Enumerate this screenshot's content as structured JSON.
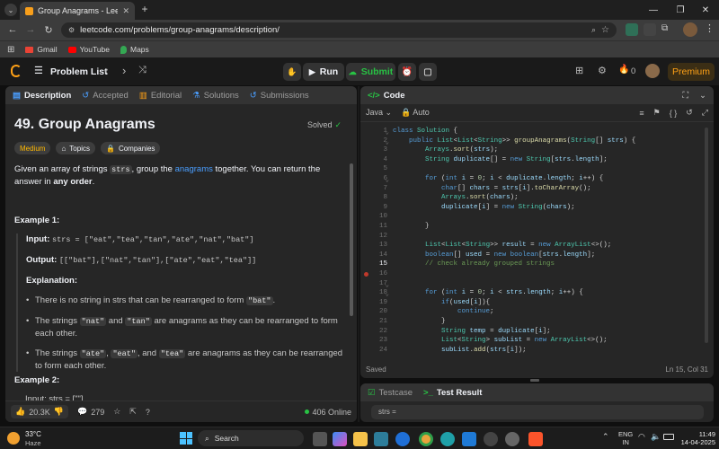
{
  "browser": {
    "tab_title": "Group Anagrams - LeetCode",
    "url": "leetcode.com/problems/group-anagrams/description/",
    "bookmarks": [
      {
        "label": "Gmail",
        "icon": "gmail-icon"
      },
      {
        "label": "YouTube",
        "icon": "youtube-icon"
      },
      {
        "label": "Maps",
        "icon": "maps-icon"
      }
    ]
  },
  "topbar": {
    "problem_list": "Problem List",
    "run": "Run",
    "submit": "Submit",
    "streak": "0",
    "premium": "Premium"
  },
  "left": {
    "tabs": [
      "Description",
      "Accepted",
      "Editorial",
      "Solutions",
      "Submissions"
    ],
    "title": "49. Group Anagrams",
    "solved": "Solved",
    "difficulty": "Medium",
    "topics": "Topics",
    "companies": "Companies",
    "desc_1": "Given an array of strings",
    "desc_code": "strs",
    "desc_2": ", group the",
    "desc_link": "anagrams",
    "desc_3": " together. You can return the answer in",
    "desc_bold": "any order",
    "desc_end": ".",
    "example1_h": "Example 1:",
    "input_label": "Input:",
    "input_val": "strs = [\"eat\",\"tea\",\"tan\",\"ate\",\"nat\",\"bat\"]",
    "output_label": "Output:",
    "output_val": "[[\"bat\"],[\"nat\",\"tan\"],[\"ate\",\"eat\",\"tea\"]]",
    "explanation": "Explanation:",
    "bullet1_a": "There is no string in strs that can be rearranged to form",
    "bullet1_c": "\"bat\"",
    "bullet1_b": ".",
    "bullet2_a": "The strings",
    "bullet2_c1": "\"nat\"",
    "bullet2_mid": "and",
    "bullet2_c2": "\"tan\"",
    "bullet2_b": "are anagrams as they can be rearranged to form each other.",
    "bullet3_a": "The strings",
    "bullet3_c1": "\"ate\"",
    "bullet3_c2": "\"eat\"",
    "bullet3_and": ", and",
    "bullet3_c3": "\"tea\"",
    "bullet3_b": "are anagrams as they can be rearranged to form each other.",
    "example2_h": "Example 2:",
    "input2": "Input: strs = [\"\"]",
    "likes": "20.3K",
    "comments": "279",
    "online": "406 Online"
  },
  "code": {
    "header": "Code",
    "language": "Java",
    "auto": "Auto",
    "status": "Saved",
    "cursor": "Ln 15, Col 31",
    "lines": [
      "class Solution {",
      "    public List<List<String>> groupAnagrams(String[] strs) {",
      "        Arrays.sort(strs);",
      "        String duplicate[] = new String[strs.length];",
      "",
      "        for (int i = 0; i < duplicate.length; i++) {",
      "            char[] chars = strs[i].toCharArray();",
      "            Arrays.sort(chars);",
      "            duplicate[i] = new String(chars);",
      "",
      "        }",
      "",
      "        List<List<String>> result = new ArrayList<>();",
      "        boolean[] used = new boolean[strs.length];",
      "        // check already grouped strings",
      "",
      "",
      "        for (int i = 0; i < strs.length; i++) {",
      "            if(used[i]){",
      "                continue;",
      "            }",
      "            String temp = duplicate[i];",
      "            List<String> subList = new ArrayList<>();",
      "            subList.add(strs[i]);"
    ]
  },
  "test": {
    "testcase": "Testcase",
    "result": "Test Result",
    "input": "strs ="
  },
  "taskbar": {
    "temp": "33°C",
    "weather": "Haze",
    "search": "Search",
    "lang1": "ENG",
    "lang2": "IN",
    "time": "11:49",
    "date": "14-04-2025"
  }
}
